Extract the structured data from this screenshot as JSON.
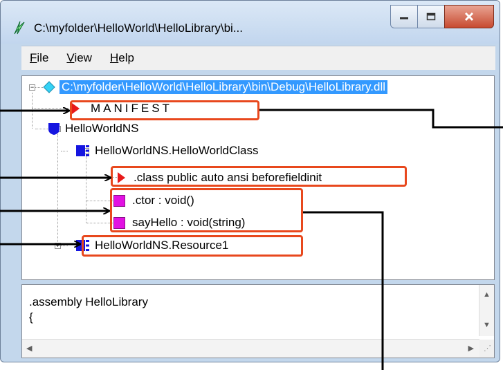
{
  "window": {
    "title": "C:\\myfolder\\HelloWorld\\HelloLibrary\\bi...",
    "minimize_glyph": "▁",
    "maximize_glyph": "□",
    "close_glyph": "✕"
  },
  "menu": {
    "items": [
      {
        "label": "File",
        "accel": "F",
        "rest": "ile"
      },
      {
        "label": "View",
        "accel": "V",
        "rest": "iew"
      },
      {
        "label": "Help",
        "accel": "H",
        "rest": "elp"
      }
    ]
  },
  "tree": {
    "root": "C:\\myfolder\\HelloWorld\\HelloLibrary\\bin\\Debug\\HelloLibrary.dll",
    "manifest": "MANIFEST",
    "namespace": "HelloWorldNS",
    "class": "HelloWorldNS.HelloWorldClass",
    "class_directive": ".class public auto ansi beforefieldinit",
    "ctor": ".ctor : void()",
    "method": "sayHello : void(string)",
    "resource": "HelloWorldNS.Resource1",
    "expand_minus": "−",
    "expand_plus": "+"
  },
  "detail": {
    "line1": ".assembly HelloLibrary",
    "line2": "{"
  },
  "scroll": {
    "up": "▲",
    "down": "▼",
    "left": "◀",
    "right": "▶",
    "grip": "⋰"
  },
  "colors": {
    "selection": "#3399ff",
    "annotation": "#e8481d",
    "class_icon": "#1515e0",
    "member_icon": "#e211e2",
    "manifest_icon": "#e81a1a"
  }
}
